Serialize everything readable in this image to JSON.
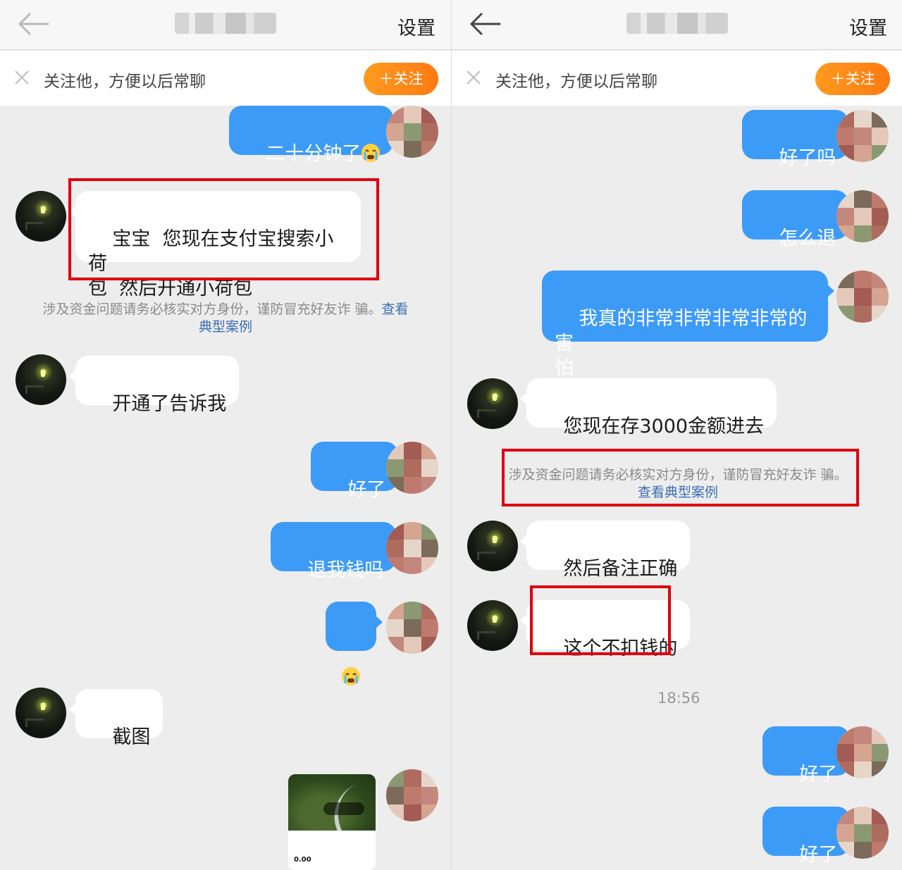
{
  "left": {
    "title": "",
    "settings_label": "设置",
    "follow_text": "关注他，方便以后常聊",
    "follow_button": "＋关注",
    "messages": [
      {
        "dir": "out",
        "text": "二十分钟了",
        "emoji": "crying-emoji"
      },
      {
        "dir": "in",
        "text": "宝宝  您现在支付宝搜索小荷\n包  然后开通小荷包"
      },
      {
        "dir": "in",
        "text": "开通了告诉我"
      },
      {
        "dir": "out",
        "text": "好了"
      },
      {
        "dir": "out",
        "text": "退我钱吗"
      },
      {
        "dir": "out",
        "text": "",
        "emoji": "crying-emoji"
      },
      {
        "dir": "in",
        "text": "截图"
      }
    ],
    "notice": {
      "text": "涉及资金问题请务必核实对方身份，谨防冒充好友诈\n骗。",
      "link": "查看典型案例"
    },
    "image_message": {
      "amount": "0.00"
    }
  },
  "right": {
    "title": "",
    "settings_label": "设置",
    "follow_text": "关注他，方便以后常聊",
    "follow_button": "＋关注",
    "messages": [
      {
        "dir": "out",
        "text": "好了吗"
      },
      {
        "dir": "out",
        "text": "怎么退"
      },
      {
        "dir": "out",
        "text": "我真的非常非常非常非常的害\n怕"
      },
      {
        "dir": "in",
        "text": "您现在存3000金额进去"
      },
      {
        "dir": "in",
        "text": "然后备注正确"
      },
      {
        "dir": "in",
        "text": "这个不扣钱的"
      },
      {
        "dir": "out",
        "text": "好了"
      },
      {
        "dir": "out",
        "text": "好了"
      }
    ],
    "notice": {
      "text": "涉及资金问题请务必核实对方身份，谨防冒充好友诈\n骗。",
      "link": "查看典型案例"
    },
    "timestamp": "18:56"
  },
  "colors": {
    "outgoing_bubble": "#3d9bf8",
    "incoming_bubble": "#ffffff",
    "follow_button": "#ff8a18",
    "highlight_box": "#e0000e",
    "link": "#3b6fb3"
  }
}
